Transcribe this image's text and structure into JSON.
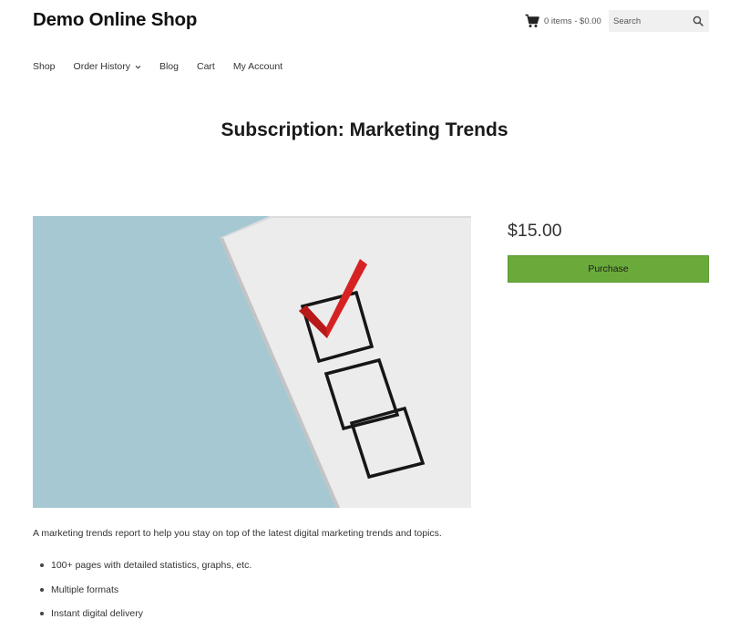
{
  "header": {
    "site_title": "Demo Online Shop",
    "cart_summary": "0 items - $0.00",
    "search_placeholder": "Search"
  },
  "nav": {
    "items": [
      {
        "label": "Shop"
      },
      {
        "label": "Order History",
        "has_dropdown": true
      },
      {
        "label": "Blog"
      },
      {
        "label": "Cart"
      },
      {
        "label": "My Account"
      }
    ]
  },
  "product": {
    "title": "Subscription: Marketing Trends",
    "price": "$15.00",
    "purchase_label": "Purchase",
    "image_icon": "checklist-icon",
    "description": "A marketing trends report to help you stay on top of the latest digital marketing trends and topics.",
    "features": [
      "100+ pages with detailed statistics, graphs, etc.",
      "Multiple formats",
      "Instant digital delivery"
    ]
  },
  "colors": {
    "purchase_button": "#6aaa3a",
    "image_background": "#a6c8d3",
    "check_mark": "#d62222"
  }
}
